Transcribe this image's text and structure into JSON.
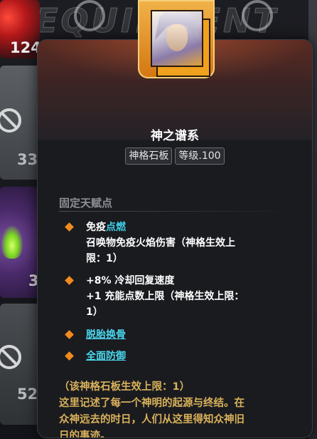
{
  "background": {
    "watermark": "EQUIPMENT",
    "slot_counts": [
      "124",
      "33",
      "3",
      "52"
    ]
  },
  "tooltip": {
    "title": "神之谱系",
    "tags": [
      "神格石板",
      "等级.100"
    ],
    "section_title": "固定天赋点",
    "talents": [
      {
        "name": "免疫",
        "keyword": "点燃",
        "lines": [
          "召唤物免疫火焰伤害（神格生效上",
          "限：1）"
        ]
      },
      {
        "lines": [
          "+8% 冷却回复速度",
          "+1 充能点数上限（神格生效上限：",
          "1）"
        ]
      },
      {
        "link": "脱胎换骨"
      },
      {
        "link": "全面防御"
      }
    ],
    "footer_lines": [
      "（该神格石板生效上限：1）",
      "这里记述了每一个神明的起源与终结。在",
      "众神远去的时日，人们从这里得知众神旧",
      "日的事迹。"
    ]
  },
  "colors": {
    "accent_orange": "#f08a1e",
    "keyword_cyan": "#3ad0e8",
    "lore_gold": "#d9b15b"
  }
}
